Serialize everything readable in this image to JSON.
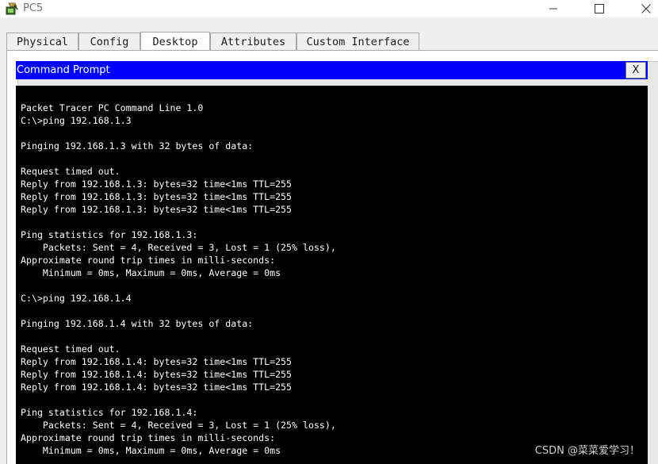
{
  "window": {
    "title": "PC5",
    "icon": "packet-tracer-pc-icon"
  },
  "tabs": [
    {
      "label": "Physical",
      "active": false
    },
    {
      "label": "Config",
      "active": false
    },
    {
      "label": "Desktop",
      "active": true
    },
    {
      "label": "Attributes",
      "active": false
    },
    {
      "label": "Custom Interface",
      "active": false
    }
  ],
  "command_prompt": {
    "title": "Command Prompt",
    "close_label": "X",
    "lines": [
      "Packet Tracer PC Command Line 1.0",
      "C:\\>ping 192.168.1.3",
      "",
      "Pinging 192.168.1.3 with 32 bytes of data:",
      "",
      "Request timed out.",
      "Reply from 192.168.1.3: bytes=32 time<1ms TTL=255",
      "Reply from 192.168.1.3: bytes=32 time<1ms TTL=255",
      "Reply from 192.168.1.3: bytes=32 time<1ms TTL=255",
      "",
      "Ping statistics for 192.168.1.3:",
      "    Packets: Sent = 4, Received = 3, Lost = 1 (25% loss),",
      "Approximate round trip times in milli-seconds:",
      "    Minimum = 0ms, Maximum = 0ms, Average = 0ms",
      "",
      "C:\\>ping 192.168.1.4",
      "",
      "Pinging 192.168.1.4 with 32 bytes of data:",
      "",
      "Request timed out.",
      "Reply from 192.168.1.4: bytes=32 time<1ms TTL=255",
      "Reply from 192.168.1.4: bytes=32 time<1ms TTL=255",
      "Reply from 192.168.1.4: bytes=32 time<1ms TTL=255",
      "",
      "Ping statistics for 192.168.1.4:",
      "    Packets: Sent = 4, Received = 3, Lost = 1 (25% loss),",
      "Approximate round trip times in milli-seconds:",
      "    Minimum = 0ms, Maximum = 0ms, Average = 0ms"
    ]
  },
  "watermark": "CSDN @菜菜爱学习！",
  "colors": {
    "header_bg": "#0000ff",
    "terminal_bg": "#000000",
    "terminal_fg": "#ffffff"
  }
}
